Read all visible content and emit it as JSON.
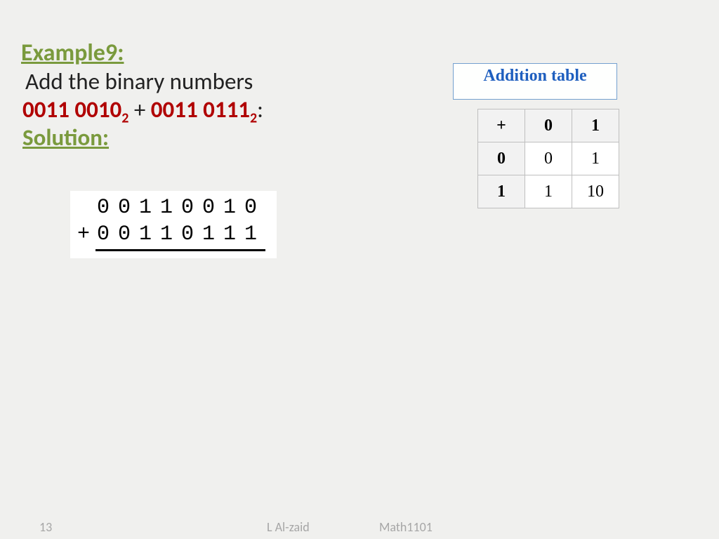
{
  "heading": "Example9:",
  "prompt": "Add the binary numbers",
  "operand1_main": "0011 0010",
  "operand1_sub": "2",
  "plus": "  +  ",
  "operand2_main": "0011 0111",
  "operand2_sub": "2",
  "colon": ":",
  "solution_label": "Solution:",
  "work": {
    "row1": "00110010",
    "row2": "00110111"
  },
  "addition": {
    "title": "Addition table",
    "corner": "+",
    "col0": "0",
    "col1": "1",
    "r0h": "0",
    "r00": "0",
    "r01": "1",
    "r1h": "1",
    "r10": "1",
    "r11": "10"
  },
  "footer": {
    "page": "13",
    "author": "L Al-zaid",
    "course": "Math1101"
  }
}
